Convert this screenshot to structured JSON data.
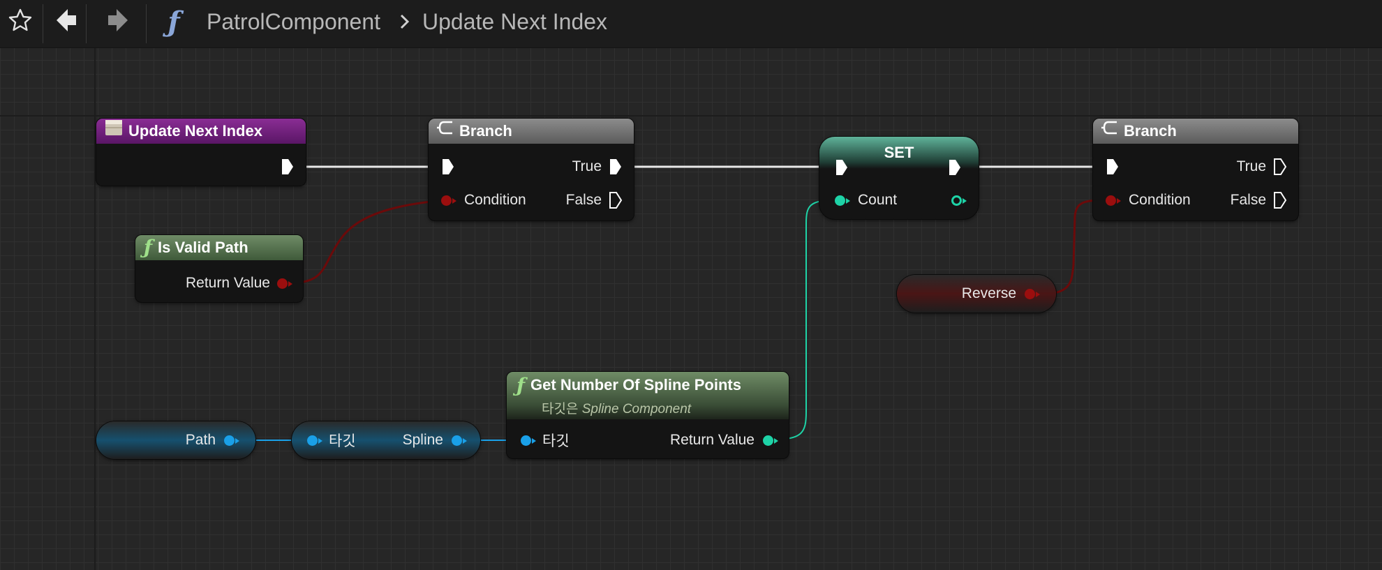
{
  "toolbar": {
    "title_parent": "PatrolComponent",
    "title_function": "Update Next Index",
    "favorite_icon": "star-icon",
    "back_icon": "back-arrow-icon",
    "forward_icon": "forward-arrow-icon",
    "function_icon": "function-icon"
  },
  "nodes": {
    "entry": {
      "title": "Update Next Index",
      "color": "#7a1f86"
    },
    "branch1": {
      "title": "Branch",
      "true_label": "True",
      "false_label": "False",
      "condition_label": "Condition"
    },
    "is_valid": {
      "title": "Is Valid Path",
      "return_label": "Return Value"
    },
    "set": {
      "title": "SET",
      "count_label": "Count"
    },
    "branch2": {
      "title": "Branch",
      "true_label": "True",
      "false_label": "False",
      "condition_label": "Condition"
    },
    "reverse": {
      "label": "Reverse"
    },
    "path": {
      "label": "Path"
    },
    "cast": {
      "target_label": "타깃",
      "spline_label": "Spline"
    },
    "get_points": {
      "title": "Get Number Of Spline Points",
      "subtitle_prefix": "타깃은",
      "subtitle_class": "Spline Component",
      "target_label": "타깃",
      "return_label": "Return Value"
    }
  },
  "colors": {
    "exec": "#ffffff",
    "bool": "#9b0e0e",
    "int": "#1ed3a7",
    "object": "#1aa0e8",
    "function_header": "#5a7a52",
    "branch_header": "#7b7b7b",
    "set_header": "#4a9c82"
  }
}
